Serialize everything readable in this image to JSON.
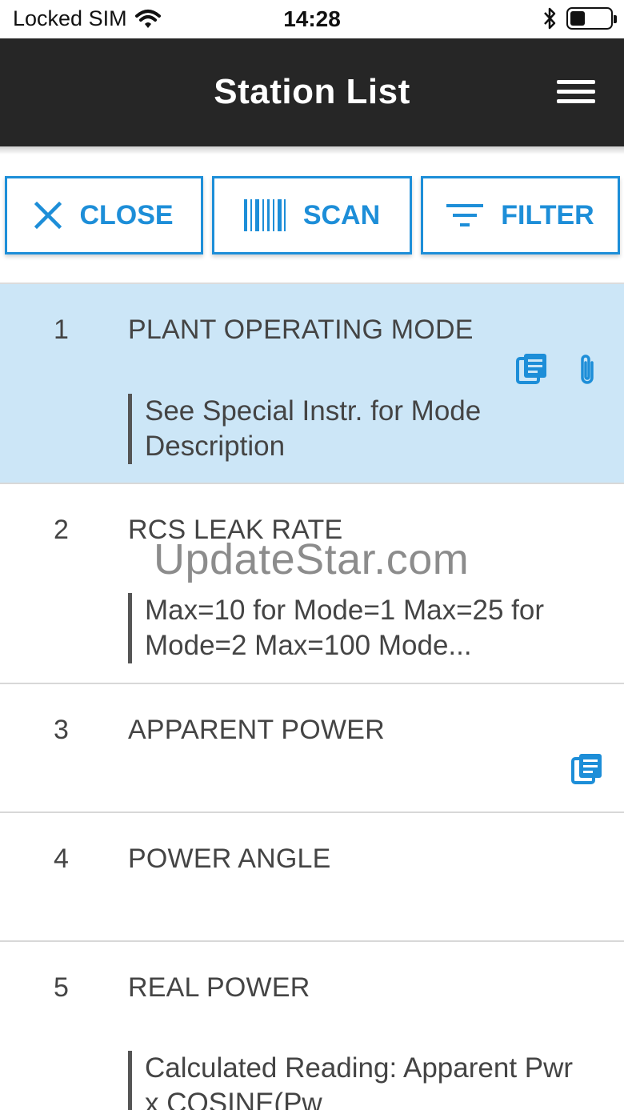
{
  "status_bar": {
    "carrier": "Locked SIM",
    "time": "14:28",
    "battery_level": 0.35,
    "icons": [
      "wifi-icon",
      "bluetooth-icon",
      "battery-icon"
    ]
  },
  "header": {
    "title": "Station List",
    "menu_icon": "hamburger-menu-icon"
  },
  "toolbar": {
    "close_label": "CLOSE",
    "scan_label": "SCAN",
    "filter_label": "FILTER",
    "accent_color": "#1d8ed8"
  },
  "stations": [
    {
      "number": "1",
      "title": "PLANT OPERATING MODE",
      "description": "See Special Instr. for Mode Description",
      "has_instructions": true,
      "has_attachment": true,
      "selected": true
    },
    {
      "number": "2",
      "title": "RCS LEAK RATE",
      "description": "Max=10 for Mode=1 Max=25 for Mode=2 Max=100 Mode...",
      "has_instructions": false,
      "has_attachment": false,
      "selected": false
    },
    {
      "number": "3",
      "title": "APPARENT POWER",
      "description": "",
      "has_instructions": true,
      "has_attachment": false,
      "selected": false
    },
    {
      "number": "4",
      "title": "POWER ANGLE",
      "description": "",
      "has_instructions": false,
      "has_attachment": false,
      "selected": false
    },
    {
      "number": "5",
      "title": "REAL POWER",
      "description": "Calculated Reading: Apparent Pwr x COSINE(Pw",
      "has_instructions": false,
      "has_attachment": false,
      "selected": false
    }
  ],
  "watermark": "UpdateStar.com",
  "colors": {
    "header_bg": "#262626",
    "selected_row_bg": "#cce6f7",
    "accent": "#1d8ed8"
  }
}
